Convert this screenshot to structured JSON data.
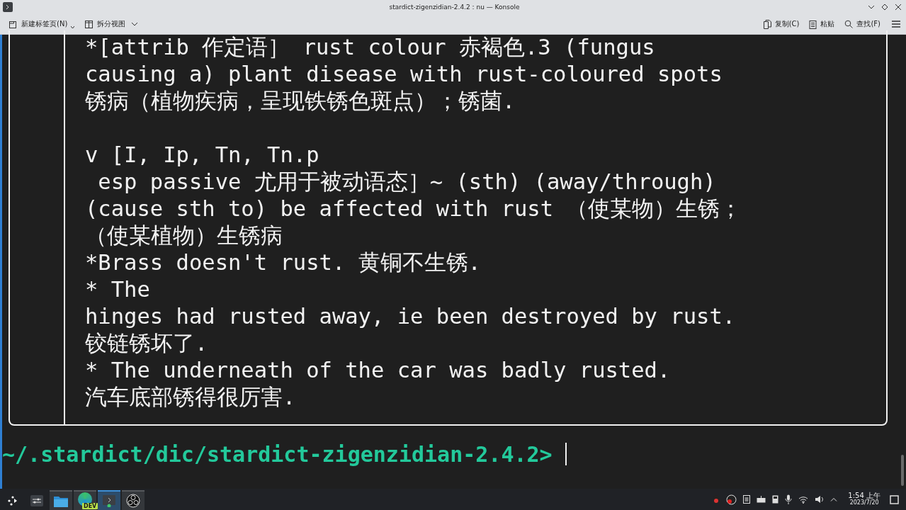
{
  "window": {
    "title": "stardict-zigenzidian-2.4.2 : nu — Konsole"
  },
  "toolbar": {
    "left": [
      {
        "label": "新建标签页(N)"
      },
      {
        "label": "拆分视图"
      }
    ],
    "right": [
      {
        "label": "复制(C)"
      },
      {
        "label": "粘贴"
      },
      {
        "label": "查找(F)"
      }
    ]
  },
  "terminal": {
    "blocks": [
      [
        "*[attrib 作定语］ rust colour 赤褐色.3 (fungus",
        "causing a) plant disease with rust-coloured spots",
        "锈病（植物疾病，呈现铁锈色斑点）；锈菌."
      ],
      [
        "v [I, Ip, Tn, Tn.p",
        " esp passive 尤用于被动语态］~ (sth) (away/through)",
        "(cause sth to) be affected with rust （使某物）生锈；",
        "（使某植物）生锈病",
        "*Brass doesn't rust. 黄铜不生锈.",
        "* The",
        "hinges had rusted away, ie been destroyed by rust.",
        "铰链锈坏了.",
        "* The underneath of the car was badly rusted.",
        "汽车底部锈得很厉害."
      ]
    ],
    "prompt": "~/.stardict/dic/stardict-zigenzidian-2.4.2>"
  },
  "taskbar": {
    "apps": [
      {
        "kind": "launcher",
        "selected": false
      },
      {
        "kind": "settings",
        "selected": false
      },
      {
        "kind": "folder",
        "selected": false
      },
      {
        "kind": "browser",
        "badge": "DEV",
        "selected": false
      },
      {
        "kind": "terminal",
        "selected": true
      },
      {
        "kind": "obs",
        "selected": false
      }
    ],
    "clock_time": "1:54 上午",
    "clock_date": "2023/7/20"
  }
}
